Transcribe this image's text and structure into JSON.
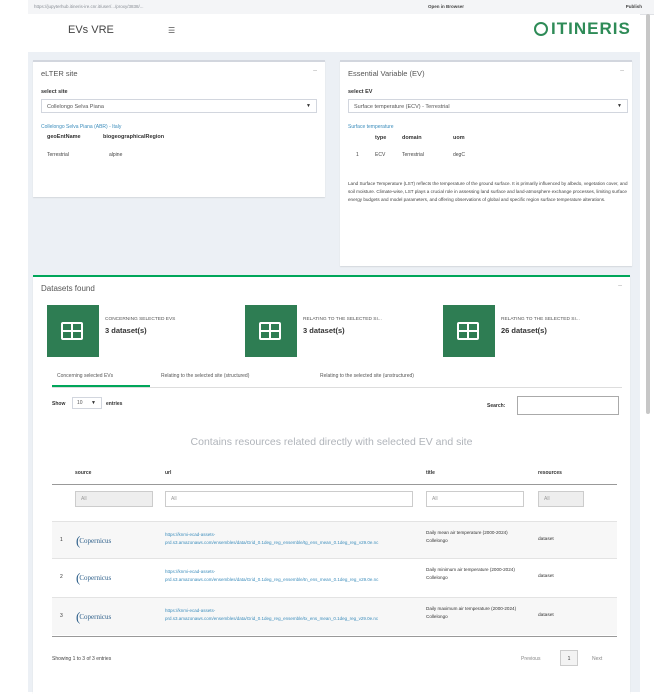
{
  "browser": {
    "url": "https://jupyterhub.itineris-ire.cnr.it/user/.../proxy/3838/...",
    "open_in_browser": "Open in Browser",
    "publish": "Publish"
  },
  "header": {
    "app_title": "EVs VRE",
    "logo_text": "ITINERIS",
    "brand_color": "#2e8b57"
  },
  "site_box": {
    "title": "eLTER site",
    "select_label": "select site",
    "selected_site": "Collelongo Selva Piana",
    "site_link": "Collelongo Selva Piana (ABR) - Italy",
    "col1": "geoEntName",
    "col2": "biogeographicalRegion",
    "val1": "Terrestrial",
    "val2": "alpine"
  },
  "ev_box": {
    "title": "Essential Variable (EV)",
    "select_label": "select EV",
    "selected_ev": "Surface temperature (ECV) - Terrestrial",
    "ev_link": "Surface temperature",
    "col_type": "type",
    "col_domain": "domain",
    "col_unit": "uom",
    "row_idx": "1",
    "row_type": "ECV",
    "row_domain": "Terrestrial",
    "row_unit": "degC",
    "description": "Land Surface Temperature (LST) reflects the temperature of the ground surface. It is primarily influenced by albedo, vegetation cover, and soil moisture. Climate-wise, LST plays a crucial role in assessing land surface and land-atmosphere exchange processes, limiting surface energy budgets and model parameters, and offering observations of global and specific region surface temperature alterations."
  },
  "datasets": {
    "title": "Datasets found",
    "infoboxes": [
      {
        "label": "CONCERNING SELECTED EVS",
        "count": "3 dataset(s)"
      },
      {
        "label": "RELATING TO THE SELECTED SI...",
        "count": "3 dataset(s)"
      },
      {
        "label": "RELATING TO THE SELECTED SI...",
        "count": "26 dataset(s)"
      }
    ],
    "tabs": [
      "Concerning selected EVs",
      "Relating to the selected site (structured)",
      "Relating to the selected site (unstructured)"
    ],
    "show": "Show",
    "show_value": "10",
    "entries": "entries",
    "search": "Search:",
    "center_title": "Contains resources related directly with selected EV and site",
    "columns": [
      "source",
      "url",
      "title",
      "resources"
    ],
    "filter": "All",
    "rows": [
      {
        "idx": "1",
        "source": "Copernicus",
        "url": "https://knmi-ecad-assets-prd.s3.amazonaws.com/ensembles/data/Grid_0.1deg_reg_ensemble/tg_ens_mean_0.1deg_reg_v29.0e.nc",
        "title": "Daily mean air temperature (2000-2024) Collelongo",
        "resources": "dataset"
      },
      {
        "idx": "2",
        "source": "Copernicus",
        "url": "https://knmi-ecad-assets-prd.s3.amazonaws.com/ensembles/data/Grid_0.1deg_reg_ensemble/tn_ens_mean_0.1deg_reg_v29.0e.nc",
        "title": "Daily minimum air temperature (2000-2024) Collelongo",
        "resources": "dataset"
      },
      {
        "idx": "3",
        "source": "Copernicus",
        "url": "https://knmi-ecad-assets-prd.s3.amazonaws.com/ensembles/data/Grid_0.1deg_reg_ensemble/tx_ens_mean_0.1deg_reg_v29.0e.nc",
        "title": "Daily maximum air temperature (2000-2024) Collelongo",
        "resources": "dataset"
      }
    ],
    "showing": "Showing 1 to 3 of 3 entries",
    "prev": "Previous",
    "page": "1",
    "next": "Next"
  }
}
